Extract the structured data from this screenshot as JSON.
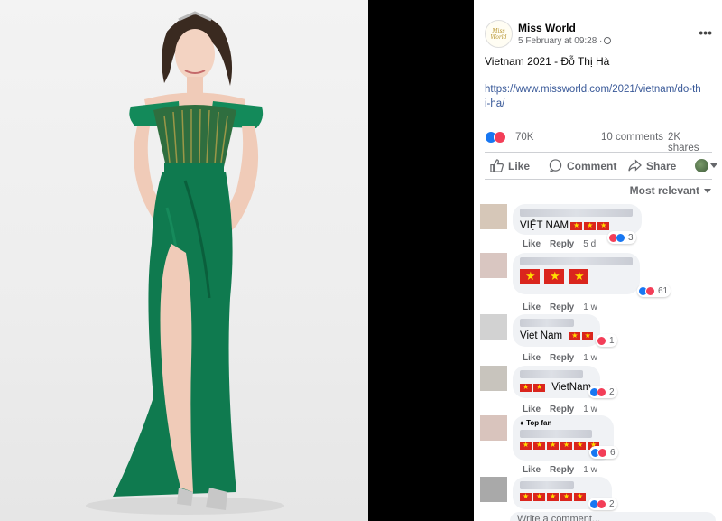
{
  "post": {
    "page_name": "Miss World",
    "logo_text": "Miss World",
    "timestamp": "5 February at 09:28 ·",
    "text": "Vietnam 2021 - Đỗ Thị Hà",
    "link": "https://www.missworld.com/2021/vietnam/do-thi-ha/",
    "reaction_count": "70K",
    "comments_count": "10 comments",
    "shares_count": "2K shares",
    "actions": {
      "like": "Like",
      "comment": "Comment",
      "share": "Share"
    },
    "sort_label": "Most relevant"
  },
  "comments": [
    {
      "text": "VIỆT NAM",
      "flags": 3,
      "meta_like": "Like",
      "meta_reply": "Reply",
      "time": "5 d",
      "reaction_count": "3"
    },
    {
      "text": "",
      "flags": 3,
      "meta_like": "Like",
      "meta_reply": "Reply",
      "time": "1 w",
      "reaction_count": "61"
    },
    {
      "text": "Viet Nam",
      "flags": 2,
      "meta_like": "Like",
      "meta_reply": "Reply",
      "time": "1 w",
      "reaction_count": "1"
    },
    {
      "text": "VietNam",
      "flags": 2,
      "meta_like": "Like",
      "meta_reply": "Reply",
      "time": "1 w",
      "reaction_count": "2"
    },
    {
      "badge": "Top fan",
      "text": "",
      "flags": 6,
      "meta_like": "Like",
      "meta_reply": "Reply",
      "time": "1 w",
      "reaction_count": "6"
    },
    {
      "text": "",
      "flags": 5,
      "reaction_count": "2"
    }
  ],
  "write_comment_placeholder": "Write a comment...",
  "colors": {
    "link": "#385898",
    "like_blue": "#1877f2",
    "love_red": "#f33e58",
    "dress_green": "#0f7a4f",
    "flag_red": "#da251d",
    "flag_star": "#ffdd00"
  }
}
